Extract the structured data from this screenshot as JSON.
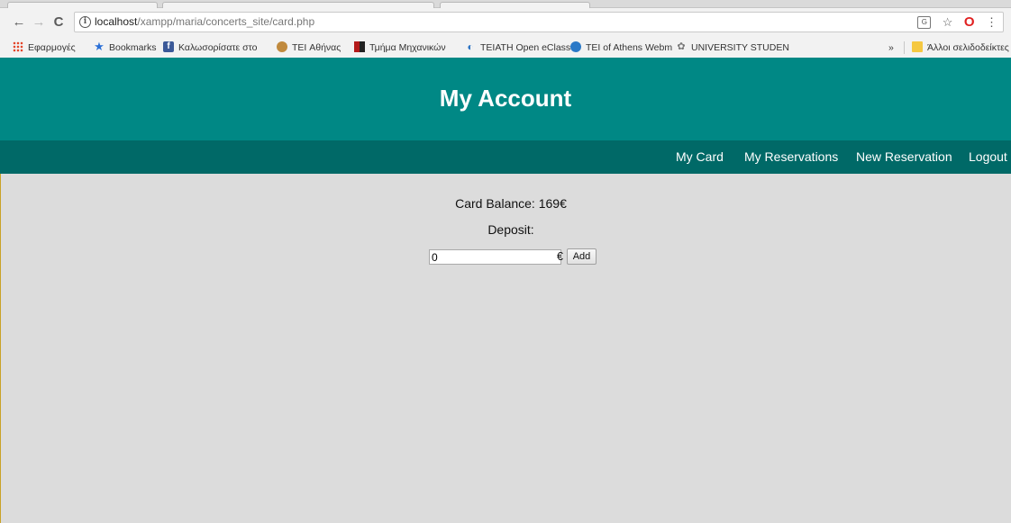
{
  "browser": {
    "url_host": "localhost",
    "url_path": "/xampp/maria/concerts_site/card.php",
    "nav": {
      "back_icon": "←",
      "forward_icon": "→",
      "reload_icon": "C"
    },
    "omnibox_icons": {
      "info": "i",
      "translate": "G",
      "star": "☆",
      "opera": "O",
      "menu": "⋮"
    },
    "bookmarks": [
      {
        "label": "Εφαρμογές",
        "icon": "apps-icon"
      },
      {
        "label": "Bookmarks",
        "icon": "star-icon"
      },
      {
        "label": "Καλωσορίσατε στο",
        "icon": "facebook-icon"
      },
      {
        "label": "TEI Αθήνας",
        "icon": "tei-logo-icon"
      },
      {
        "label": "Τμήμα Μηχανικών",
        "icon": "department-icon"
      },
      {
        "label": "TEIATH Open eClass",
        "icon": "eclass-icon"
      },
      {
        "label": "TEI of Athens Webm",
        "icon": "webmail-icon"
      },
      {
        "label": "UNIVERSITY STUDEN",
        "icon": "university-icon"
      }
    ],
    "bookmarks_overflow": "»",
    "other_bookmarks": "Άλλοι σελιδοδείκτες",
    "fb_letter": "f"
  },
  "page": {
    "title": "My Account",
    "menu": [
      "My Card",
      "My Reservations",
      "New Reservation",
      "Logout"
    ],
    "balance_text": "Card Balance: 169€",
    "deposit_label": "Deposit:",
    "deposit_value": "0",
    "currency": "€",
    "add_button": "Add"
  },
  "colors": {
    "header_bg": "#008885",
    "navbar_bg": "#006967",
    "content_bg": "#dcdcdc"
  }
}
